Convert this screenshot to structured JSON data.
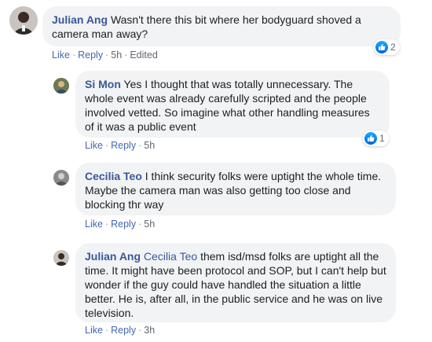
{
  "comments": [
    {
      "author": "Julian Ang",
      "text": "Wasn't there this bit where her bodyguard shoved a camera man away?",
      "mention": "",
      "actions": {
        "like": "Like",
        "reply": "Reply",
        "time": "5h",
        "edited": "Edited"
      },
      "reaction_count": "2"
    },
    {
      "author": "Si Mon",
      "text": "Yes I thought that was totally unnecessary. The whole event was already carefully scripted and the people involved vetted. So imagine what other handling measures of it was a public event",
      "mention": "",
      "actions": {
        "like": "Like",
        "reply": "Reply",
        "time": "5h"
      },
      "reaction_count": "1"
    },
    {
      "author": "Cecilia Teo",
      "text": "I think security folks were uptight the whole time. Maybe the camera man was also getting too close and blocking thr way",
      "mention": "",
      "actions": {
        "like": "Like",
        "reply": "Reply",
        "time": "5h"
      }
    },
    {
      "author": "Julian Ang",
      "mention": "Cecilia Teo",
      "text": "them isd/msd folks are uptight all the time. It might have been protocol and SOP, but I can't help but wonder if the guy could have handled the situation a little better. He is, after all, in the public service and he was on live television.",
      "actions": {
        "like": "Like",
        "reply": "Reply",
        "time": "3h"
      }
    }
  ],
  "colors": {
    "author": "#385898",
    "link": "#4267b2",
    "bubble": "#f2f3f5",
    "like_blue": "#0a7cff"
  },
  "icons": {
    "like_reaction": "thumbs-up-icon"
  }
}
